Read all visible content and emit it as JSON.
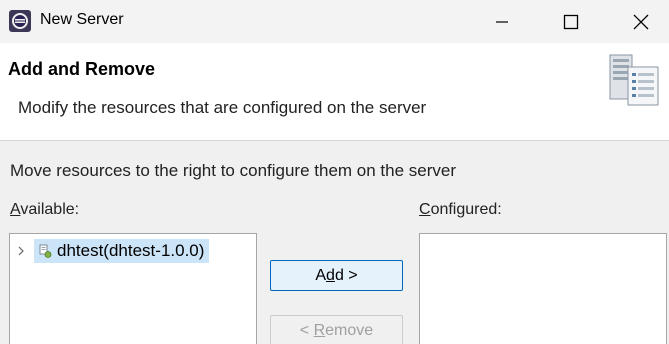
{
  "window": {
    "title": "New Server"
  },
  "banner": {
    "title": "Add and Remove",
    "description": "Modify the resources that are configured on the server"
  },
  "body": {
    "instruction": "Move resources to the right to configure them on the server",
    "available_label": {
      "mnemonic": "A",
      "rest": "vailable:"
    },
    "configured_label": {
      "mnemonic": "C",
      "rest": "onfigured:"
    }
  },
  "available_list": {
    "items": [
      {
        "label": "dhtest(dhtest-1.0.0)",
        "icon": "module-icon",
        "selected": true,
        "expandable": true
      }
    ]
  },
  "configured_list": {
    "items": []
  },
  "buttons": {
    "add": {
      "pre": "A",
      "mnemonic": "d",
      "post": "d >"
    },
    "remove": {
      "pre": "< ",
      "mnemonic": "R",
      "post": "emove",
      "enabled": false
    }
  },
  "colors": {
    "selection": "#cce4f7",
    "accent": "#0067c0",
    "banner_bg": "#ffffff",
    "dialog_bg": "#f0f0f0"
  }
}
